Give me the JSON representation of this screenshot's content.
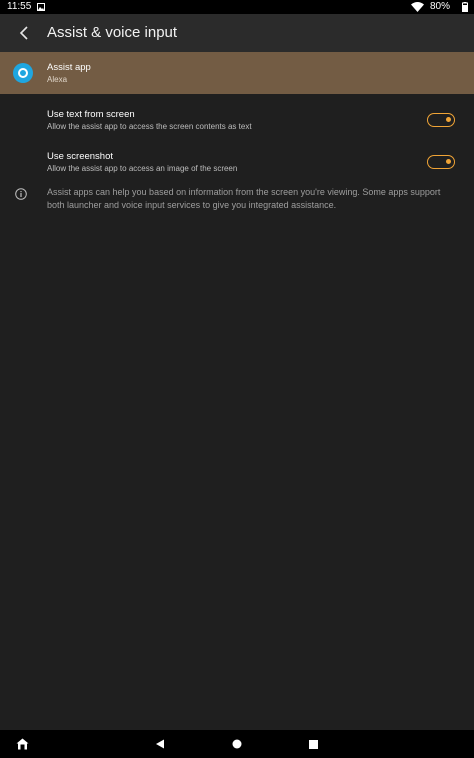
{
  "status_bar": {
    "time": "11:55",
    "battery": "80%",
    "icons": [
      "image-icon",
      "wifi-icon",
      "battery-icon"
    ]
  },
  "toolbar": {
    "back_icon": "chevron-left-icon",
    "title": "Assist & voice input"
  },
  "assist_app": {
    "title": "Assist app",
    "value": "Alexa",
    "icon": "alexa-icon",
    "highlight_color": "#735c44"
  },
  "settings": [
    {
      "title": "Use text from screen",
      "subtitle": "Allow the assist app to access the screen contents as text",
      "enabled": true
    },
    {
      "title": "Use screenshot",
      "subtitle": "Allow the assist app to access an image of the screen",
      "enabled": true
    }
  ],
  "info": {
    "icon": "info-icon",
    "text": "Assist apps can help you based on information from the screen you're viewing. Some apps support both launcher and voice input services to give you integrated assistance."
  },
  "nav_bar": {
    "items": [
      "home-app-icon",
      "back-triangle-icon",
      "home-circle-icon",
      "recents-square-icon"
    ]
  },
  "colors": {
    "background": "#1f1f1f",
    "toolbar": "#2b2b2b",
    "accent": "#f0a436",
    "alexa_blue": "#1fa6e0"
  }
}
